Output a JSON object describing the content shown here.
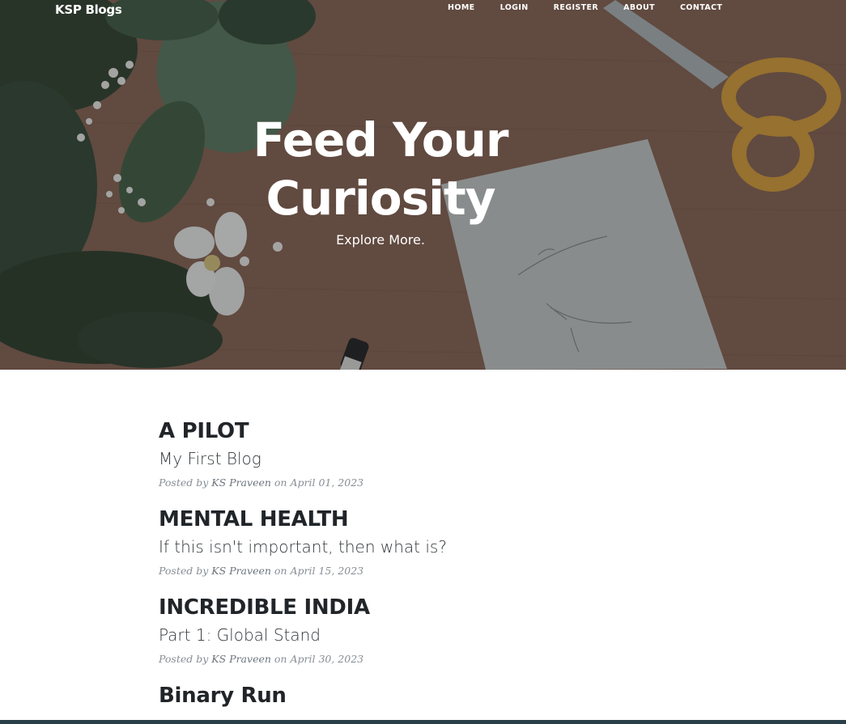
{
  "brand": "KSP Blogs",
  "nav": {
    "home": "HOME",
    "login": "LOGIN",
    "register": "REGISTER",
    "about": "ABOUT",
    "contact": "CONTACT"
  },
  "hero": {
    "heading_line1": "Feed Your",
    "heading_line2": "Curiosity",
    "subheading": "Explore More."
  },
  "posts": [
    {
      "title": "A PILOT",
      "subtitle": "My First Blog",
      "meta_prefix": "Posted by",
      "author": "KS Praveen",
      "meta_on": "on",
      "date": "April 01, 2023"
    },
    {
      "title": "MENTAL HEALTH",
      "subtitle": "If this isn't important, then what is?",
      "meta_prefix": "Posted by",
      "author": "KS Praveen",
      "meta_on": "on",
      "date": "April 15, 2023"
    },
    {
      "title": "INCREDIBLE INDIA",
      "subtitle": "Part 1: Global Stand",
      "meta_prefix": "Posted by",
      "author": "KS Praveen",
      "meta_on": "on",
      "date": "April 30, 2023"
    },
    {
      "title": "Binary Run"
    }
  ],
  "colors": {
    "text_dark": "#212529",
    "meta_gray": "#868e96",
    "bottom_bar": "#2a4048"
  }
}
